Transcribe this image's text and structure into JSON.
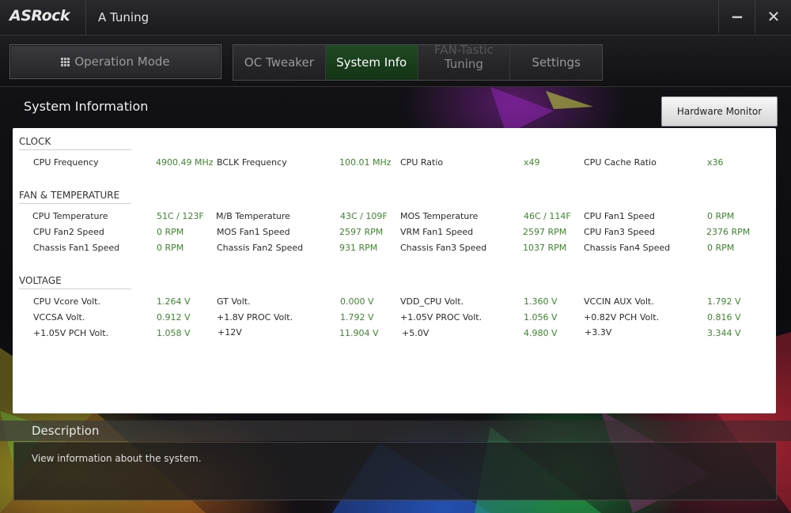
{
  "app": {
    "logo": "ASRock",
    "title": "A Tuning"
  },
  "window_controls": {
    "minimize_label": "−",
    "close_label": "✕"
  },
  "nav": {
    "operation_mode": "Operation Mode",
    "tabs": [
      {
        "label": "OC Tweaker",
        "active": false
      },
      {
        "label": "System Info",
        "active": true
      },
      {
        "label_top": "FAN-Tastic",
        "label_bottom": "Tuning",
        "active": false
      },
      {
        "label": "Settings",
        "active": false
      }
    ]
  },
  "section_title": "System Information",
  "hardware_monitor_label": "Hardware Monitor",
  "groups": {
    "clock": "CLOCK",
    "fan": "FAN & TEMPERATURE",
    "voltage": "VOLTAGE"
  },
  "clock": [
    {
      "label": "CPU Frequency",
      "value": "4900.49 MHz"
    },
    {
      "label": "BCLK Frequency",
      "value": "100.01 MHz"
    },
    {
      "label": "CPU Ratio",
      "value": "x49"
    },
    {
      "label": "CPU Cache Ratio",
      "value": "x36"
    }
  ],
  "fan": [
    {
      "label": "CPU Temperature",
      "value": "51C / 123F"
    },
    {
      "label": "M/B Temperature",
      "value": "43C / 109F"
    },
    {
      "label": "MOS Temperature",
      "value": "46C / 114F"
    },
    {
      "label": "CPU Fan1 Speed",
      "value": "0 RPM"
    },
    {
      "label": "CPU Fan2 Speed",
      "value": "0 RPM"
    },
    {
      "label": "MOS Fan1 Speed",
      "value": "2597 RPM"
    },
    {
      "label": "VRM Fan1 Speed",
      "value": "2597 RPM"
    },
    {
      "label": "CPU Fan3 Speed",
      "value": "2376 RPM"
    },
    {
      "label": "Chassis Fan1 Speed",
      "value": "0 RPM"
    },
    {
      "label": "Chassis Fan2 Speed",
      "value": "931 RPM"
    },
    {
      "label": "Chassis Fan3 Speed",
      "value": "1037 RPM"
    },
    {
      "label": "Chassis Fan4 Speed",
      "value": "0 RPM"
    }
  ],
  "voltage": [
    {
      "label": "CPU Vcore Volt.",
      "value": "1.264 V"
    },
    {
      "label": "GT Volt.",
      "value": "0.000 V"
    },
    {
      "label": "VDD_CPU Volt.",
      "value": "1.360 V"
    },
    {
      "label": "VCCIN AUX Volt.",
      "value": "1.792 V"
    },
    {
      "label": "VCCSA Volt.",
      "value": "0.912 V"
    },
    {
      "label": "+1.8V PROC Volt.",
      "value": "1.792 V"
    },
    {
      "label": "+1.05V PROC Volt.",
      "value": "1.056 V"
    },
    {
      "label": "+0.82V PCH Volt.",
      "value": "0.816 V"
    },
    {
      "label": "+1.05V PCH Volt.",
      "value": "1.058 V"
    },
    {
      "label": "+12V",
      "value": "11.904 V"
    },
    {
      "label": "+5.0V",
      "value": "4.980 V"
    },
    {
      "label": "+3.3V",
      "value": "3.344 V"
    }
  ],
  "description": {
    "title": "Description",
    "text": "View information about the system."
  },
  "colors": {
    "active_tab": "#1f4a22",
    "value_green": "#3a8a2a"
  }
}
